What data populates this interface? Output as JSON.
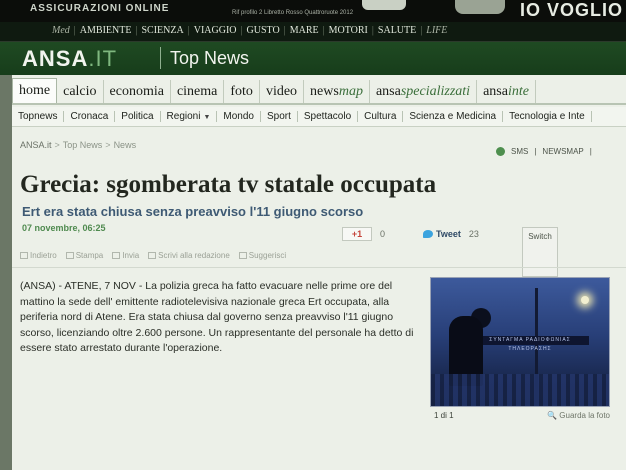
{
  "ad": {
    "left_text": "ASSICURAZIONI ONLINE",
    "middle_text": "Rif profilo 2 Libretto Rosso Quattroruote 2012",
    "right_text": "IO VOGLIO"
  },
  "topnav": {
    "brand": "Med",
    "items": [
      "AMBIENTE",
      "SCIENZA",
      "VIAGGIO",
      "GUSTO",
      "MARE",
      "MOTORI",
      "SALUTE"
    ],
    "tail": "LIFE"
  },
  "header": {
    "logo_main": "ANSA",
    "logo_suffix": ".IT",
    "section": "Top News"
  },
  "tabs": [
    {
      "label": "home",
      "active": true
    },
    {
      "label": "calcio"
    },
    {
      "label": "economia"
    },
    {
      "label": "cinema"
    },
    {
      "label": "foto"
    },
    {
      "label": "video"
    },
    {
      "label": "news",
      "em": "map"
    },
    {
      "label": "ansa",
      "em": "specializzati"
    },
    {
      "label": "ansa",
      "em": "inte"
    }
  ],
  "subnav": [
    "Topnews",
    "Cronaca",
    "Politica",
    "Regioni",
    "Mondo",
    "Sport",
    "Spettacolo",
    "Cultura",
    "Scienza e Medicina",
    "Tecnologia e Inte"
  ],
  "breadcrumb": [
    "ANSA.it",
    "Top News",
    "News"
  ],
  "tools_right": [
    "SMS",
    "NEWSMAP"
  ],
  "article": {
    "headline": "Grecia: sgomberata tv statale occupata",
    "subhead": "Ert era stata chiusa senza preavviso l'11 giugno scorso",
    "date": "07 novembre, 06:25",
    "gplus_label": "+1",
    "gplus_count": "0",
    "tweet_label": "Tweet",
    "tweet_count": "23",
    "switch_label": "Switch",
    "actions": [
      "Indietro",
      "Stampa",
      "Invia",
      "Scrivi alla redazione",
      "Suggerisci"
    ],
    "body": "(ANSA) - ATENE, 7 NOV - La polizia greca ha fatto evacuare nelle prime ore del mattino la sede dell' emittente radiotelevisiva nazionale greca Ert occupata, alla periferia nord di Atene. Era stata chiusa dal governo senza preavviso l'11 giugno scorso, licenziando oltre 2.600 persone. Un rappresentante del personale ha detto di essere stato arrestato durante l'operazione.",
    "photo_banner": "ΣΥΝΤΑΓΜΑ ΡΑΔΙΟΦΩΝΙΑΣ ΤΗΛΕΟΡΑΣΗΣ",
    "photo_index": "1 di 1",
    "photo_link": "Guarda la foto"
  }
}
